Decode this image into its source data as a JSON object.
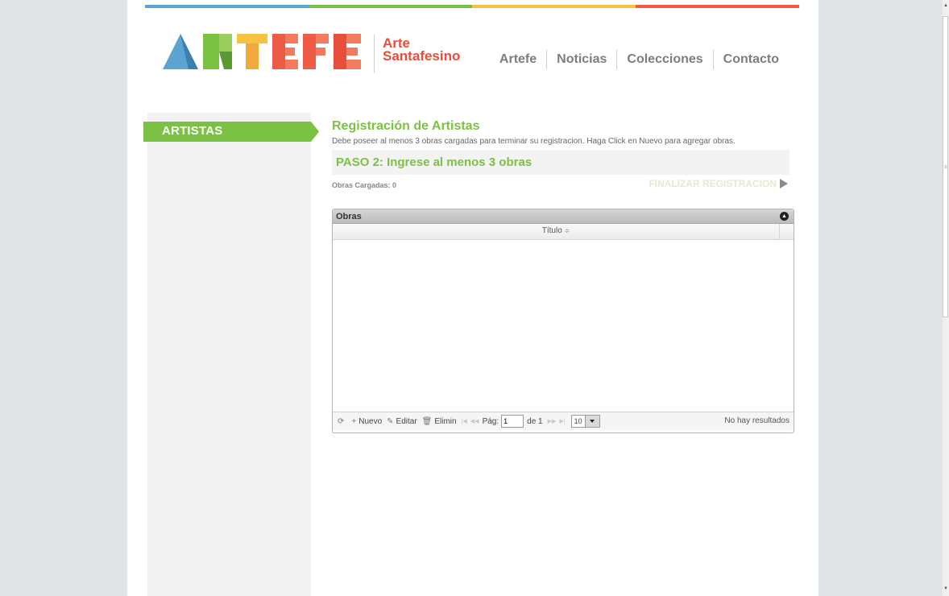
{
  "colors": {
    "topbar": [
      "#5ba3d0",
      "#7bc143",
      "#f5c242",
      "#ee5a46"
    ],
    "accent_green": "#7bc143",
    "logo_red": "#e84e3b"
  },
  "header": {
    "logo_alt": "ARTEFE",
    "logo_text_line1": "Arte",
    "logo_text_line2": "Santafesino",
    "nav": [
      {
        "label": "Artefe",
        "icon": ""
      },
      {
        "label": "Noticias",
        "icon": ""
      },
      {
        "label": "Colecciones",
        "icon": ""
      },
      {
        "label": "Contacto",
        "icon": ""
      }
    ]
  },
  "sidebar": {
    "tab_label": "ARTISTAS"
  },
  "main": {
    "title": "Registración de Artistas",
    "description": "Debe poseer al menos 3 obras cargadas para terminar su registracion. Haga Click en Nuevo para agregar obras.",
    "step_title": "PASO 2: Ingrese al menos 3 obras",
    "obras_count": "Obras Cargadas: 0",
    "finalize_label": "FINALIZAR REGISTRACION"
  },
  "grid": {
    "caption": "Obras",
    "column_header": "Título",
    "pager": {
      "refresh_icon": "refresh-icon",
      "new_label": "Nuevo",
      "edit_label": "Editar",
      "delete_label": "Elimin",
      "page_label": "Pág:",
      "page_value": "1",
      "of_label": "de 1",
      "rows_per_page": "10",
      "no_results": "No hay resultados"
    }
  }
}
